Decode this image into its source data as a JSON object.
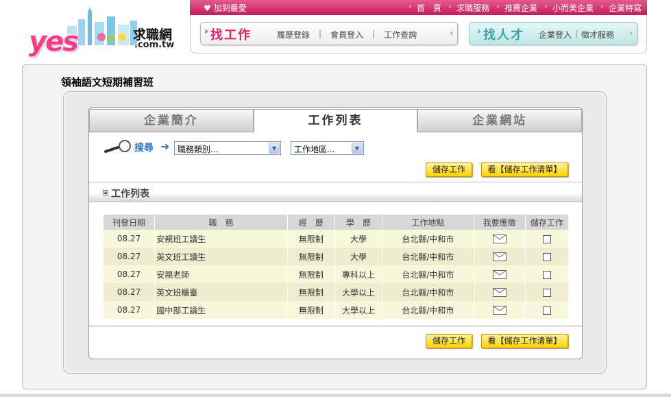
{
  "header": {
    "logo_text": "yes",
    "brand_name": "求職網",
    "brand_domain": ".com.tw",
    "favorite_label": "加到最愛",
    "top_nav": [
      "首　頁",
      "求職服務",
      "推薦企業",
      "小而美企業",
      "企業特寫"
    ],
    "find_job": {
      "title": "找工作",
      "links": [
        "履歷登錄",
        "會員登入",
        "工作查詢"
      ]
    },
    "find_talent": {
      "title": "找人才",
      "links": [
        "企業登入",
        "徵才服務"
      ]
    },
    "colors": {
      "brand_pink": "#e2206b",
      "teal": "#3aa3a8"
    }
  },
  "company": {
    "name": "領袖語文短期補習班"
  },
  "tabs": [
    {
      "label": "企業簡介",
      "active": false
    },
    {
      "label": "工作列表",
      "active": true
    },
    {
      "label": "企業網站",
      "active": false
    }
  ],
  "search": {
    "label": "搜尋",
    "category_value": "職務類別...",
    "area_value": "工作地區..."
  },
  "buttons": {
    "save_job": "儲存工作",
    "view_saved": "看【儲存工作清單】"
  },
  "section": {
    "title": "工作列表"
  },
  "table": {
    "headers": [
      "刊登日期",
      "職　務",
      "經　歷",
      "學　歷",
      "工作地點",
      "我要應徵",
      "儲存工作"
    ],
    "rows": [
      {
        "date": "08.27",
        "title": "安親班工讀生",
        "experience": "無限制",
        "education": "大學",
        "location": "台北縣/中和市"
      },
      {
        "date": "08.27",
        "title": "英文班工讀生",
        "experience": "無限制",
        "education": "大學",
        "location": "台北縣/中和市"
      },
      {
        "date": "08.27",
        "title": "安親老師",
        "experience": "無限制",
        "education": "專科以上",
        "location": "台北縣/中和市"
      },
      {
        "date": "08.27",
        "title": "英文班櫃臺",
        "experience": "無限制",
        "education": "大學以上",
        "location": "台北縣/中和市"
      },
      {
        "date": "08.27",
        "title": "國中部工讀生",
        "experience": "無限制",
        "education": "大學以上",
        "location": "台北縣/中和市"
      }
    ]
  }
}
